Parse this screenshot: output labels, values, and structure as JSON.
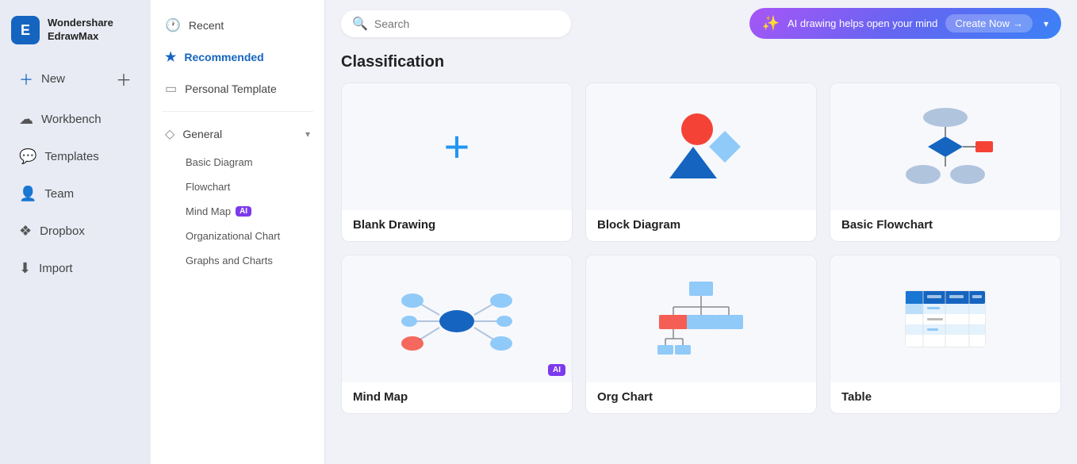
{
  "app": {
    "logo_line1": "Wondershare",
    "logo_line2": "EdrawMax",
    "logo_letter": "E"
  },
  "left_nav": {
    "new": "New",
    "workbench": "Workbench",
    "templates": "Templates",
    "team": "Team",
    "dropbox": "Dropbox",
    "import": "Import"
  },
  "mid_nav": {
    "recent": "Recent",
    "recommended": "Recommended",
    "personal_template": "Personal Template",
    "general": "General",
    "sub_items": [
      {
        "label": "Basic Diagram"
      },
      {
        "label": "Flowchart"
      },
      {
        "label": "Mind Map",
        "ai": true
      },
      {
        "label": "Organizational Chart"
      },
      {
        "label": "Graphs and Charts"
      }
    ]
  },
  "top_bar": {
    "search_placeholder": "Search",
    "ai_banner_text": "AI drawing helps open your mind",
    "create_now": "Create Now"
  },
  "main": {
    "section_title": "Classification",
    "cards": [
      {
        "label": "Blank Drawing",
        "type": "blank"
      },
      {
        "label": "Block Diagram",
        "type": "block"
      },
      {
        "label": "Basic Flowchart",
        "type": "flowchart"
      },
      {
        "label": "Mind Map",
        "type": "mindmap",
        "ai": true
      },
      {
        "label": "Org Chart",
        "type": "orgchart"
      },
      {
        "label": "Table",
        "type": "table"
      }
    ]
  }
}
